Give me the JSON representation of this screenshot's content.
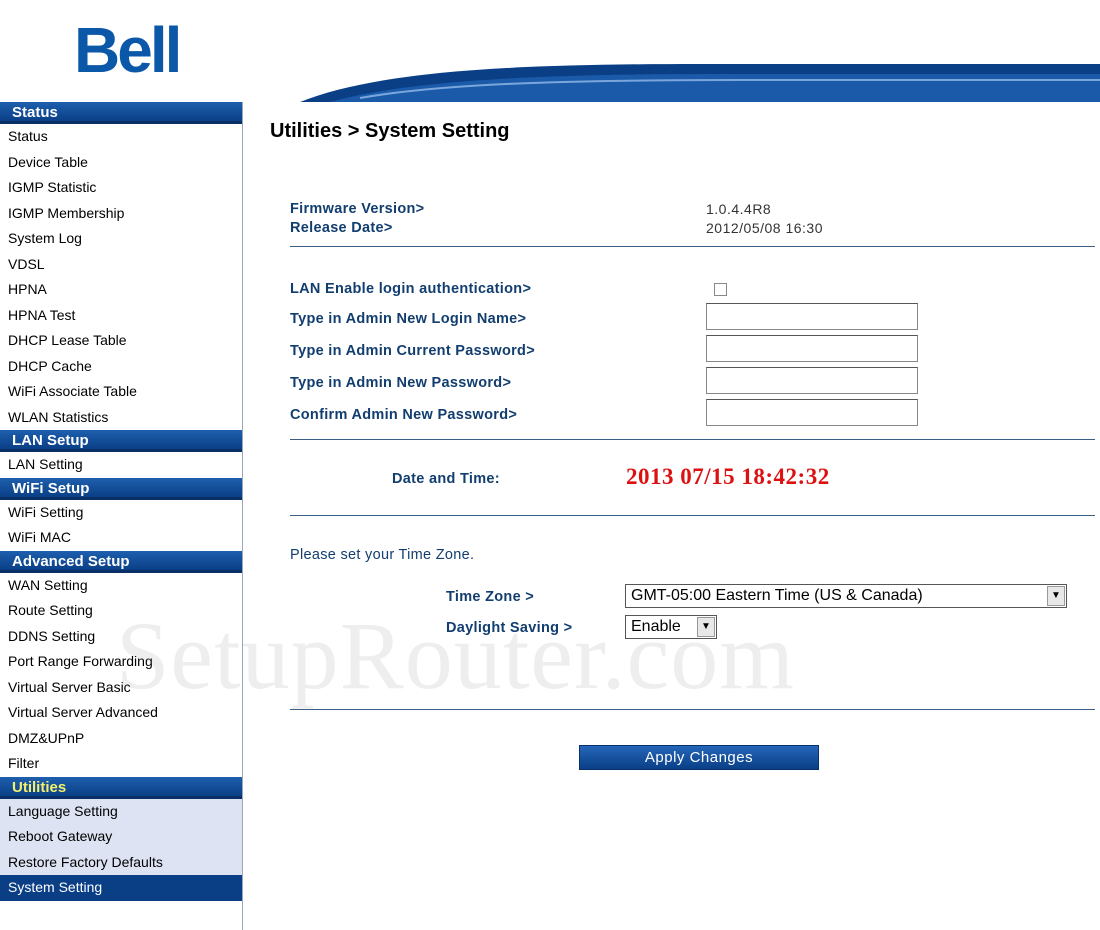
{
  "brand": {
    "logo": "Bell",
    "accent": "#0b57a8",
    "nav_header_color": "#0a3f86"
  },
  "sidebar": {
    "sections": [
      {
        "title": "Status",
        "items": [
          "Status",
          "Device Table",
          "IGMP Statistic",
          "IGMP Membership",
          "System Log",
          "VDSL",
          "HPNA",
          "HPNA Test",
          "DHCP Lease Table",
          "DHCP Cache",
          "WiFi Associate Table",
          "WLAN Statistics"
        ]
      },
      {
        "title": "LAN Setup",
        "items": [
          "LAN Setting"
        ]
      },
      {
        "title": "WiFi Setup",
        "items": [
          "WiFi Setting",
          "WiFi MAC"
        ]
      },
      {
        "title": "Advanced Setup",
        "items": [
          "WAN Setting",
          "Route Setting",
          "DDNS Setting",
          "Port Range Forwarding",
          "Virtual Server Basic",
          "Virtual Server Advanced",
          "DMZ&UPnP",
          "Filter"
        ]
      },
      {
        "title": "Utilities",
        "items": [
          "Language Setting",
          "Reboot Gateway",
          "Restore Factory Defaults",
          "System Setting"
        ],
        "active_item": "System Setting"
      }
    ]
  },
  "main": {
    "title": "Utilities > System Setting",
    "firmware": {
      "label": "Firmware Version>",
      "value": "1.0.4.4R8"
    },
    "release": {
      "label": "Release Date>",
      "value": "2012/05/08 16:30"
    },
    "auth": {
      "lan_login_label": "LAN Enable login authentication>",
      "lan_login_checked": false,
      "login_name_label": "Type in Admin New Login Name>",
      "current_password_label": "Type in Admin Current Password>",
      "new_password_label": "Type in Admin New Password>",
      "confirm_password_label": "Confirm Admin New Password>"
    },
    "datetime": {
      "label": "Date and Time:",
      "value": "2013 07/15 18:42:32"
    },
    "timezone": {
      "note": "Please set your Time Zone.",
      "tz_label": "Time Zone >",
      "tz_value": "GMT-05:00 Eastern Time (US & Canada)",
      "dst_label": "Daylight Saving >",
      "dst_value": "Enable"
    },
    "apply_label": "Apply Changes"
  },
  "watermark": "SetupRouter.com"
}
